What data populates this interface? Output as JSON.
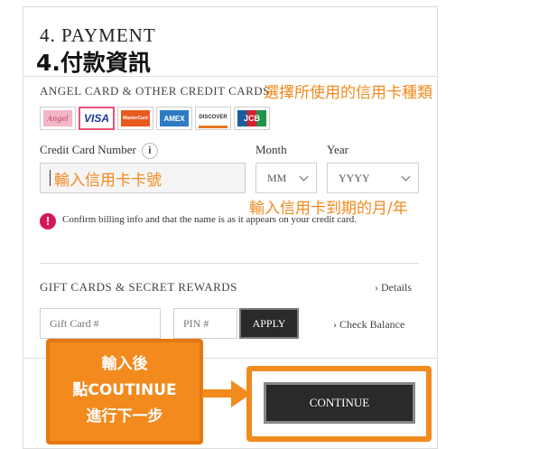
{
  "section": {
    "title": "4. PAYMENT",
    "title_zh": "4.付款資訊"
  },
  "cards_section": {
    "heading": "ANGEL CARD & OTHER CREDIT CARDS",
    "note": "選擇所使用的信用卡種類",
    "cards": [
      {
        "label": "Angel",
        "bg": "#f3b7c6",
        "color": "#c13c66",
        "icon": "angel-card-icon"
      },
      {
        "label": "VISA",
        "bg": "#ffffff",
        "color": "#1a3a8f",
        "icon": "visa-card-icon"
      },
      {
        "label": "MasterCard",
        "bg": "#e85a1e",
        "color": "#ffffff",
        "icon": "mastercard-icon"
      },
      {
        "label": "AMEX",
        "bg": "#2e7bc4",
        "color": "#ffffff",
        "icon": "amex-card-icon"
      },
      {
        "label": "DISCOVER",
        "bg": "#ffffff",
        "color": "#e6761e",
        "icon": "discover-card-icon"
      },
      {
        "label": "JCB",
        "bg": "#ffffff",
        "color": "#1a5e9e",
        "icon": "jcb-card-icon"
      }
    ]
  },
  "card_form": {
    "number_label": "Credit Card Number",
    "info_glyph": "i",
    "number_annotation": "輸入信用卡卡號",
    "month_label": "Month",
    "month_value": "MM",
    "year_label": "Year",
    "year_value": "YYYY",
    "expiry_note": "輸入信用卡到期的月/年"
  },
  "warning": {
    "glyph": "!",
    "text": "Confirm billing info and that the name is as it appears on your credit card."
  },
  "gift": {
    "heading": "GIFT CARDS & SECRET REWARDS",
    "details_link": "› Details",
    "gift_card_placeholder": "Gift Card #",
    "pin_placeholder": "PIN #",
    "apply_label": "APPLY",
    "check_balance_link": "› Check Balance"
  },
  "footer": {
    "continue_label": "CONTINUE",
    "callout_lines": [
      "輸入後",
      "點COUTINUE",
      "進行下一步"
    ]
  },
  "colors": {
    "annotation_orange": "#f28a1e",
    "warning_pink": "#d6185a",
    "dark_button": "#2a2a2a"
  }
}
